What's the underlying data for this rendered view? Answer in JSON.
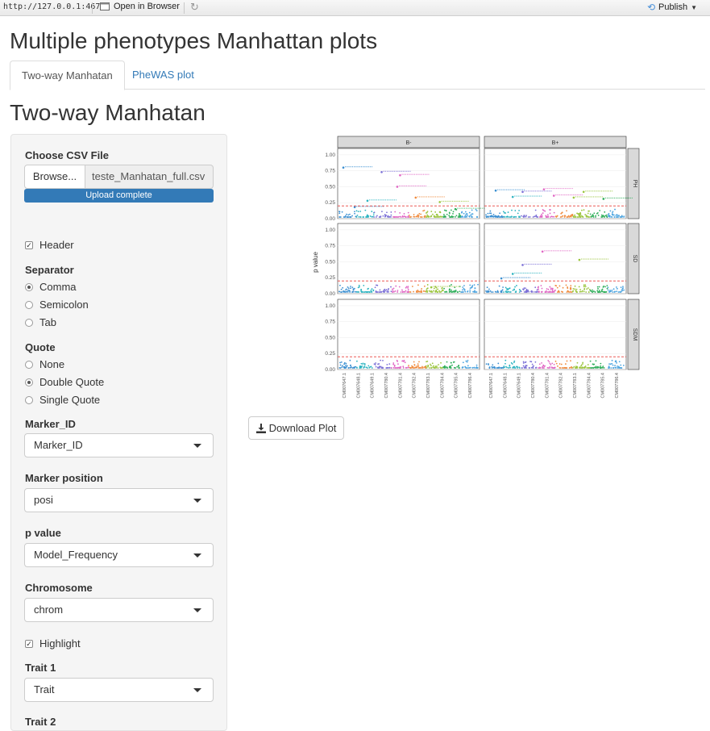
{
  "browser": {
    "url": "http://127.0.0.1:4679",
    "open_in_browser": "Open in Browser",
    "publish": "Publish"
  },
  "app_title": "Multiple phenotypes Manhattan plots",
  "tabs": [
    {
      "label": "Two-way Manhatan",
      "active": true
    },
    {
      "label": "PheWAS plot",
      "active": false
    }
  ],
  "section_title": "Two-way Manhatan",
  "sidebar": {
    "file_label": "Choose CSV File",
    "browse_label": "Browse...",
    "file_name": "teste_Manhatan_full.csv",
    "upload_status": "Upload complete",
    "header_label": "Header",
    "header_checked": true,
    "separator_label": "Separator",
    "separator_options": [
      "Comma",
      "Semicolon",
      "Tab"
    ],
    "separator_selected": "Comma",
    "quote_label": "Quote",
    "quote_options": [
      "None",
      "Double Quote",
      "Single Quote"
    ],
    "quote_selected": "Double Quote",
    "marker_id_label": "Marker_ID",
    "marker_id_value": "Marker_ID",
    "marker_pos_label": "Marker position",
    "marker_pos_value": "posi",
    "pvalue_label": "p value",
    "pvalue_value": "Model_Frequency",
    "chrom_label": "Chromosome",
    "chrom_value": "chrom",
    "highlight_label": "Highlight",
    "highlight_checked": true,
    "trait1_label": "Trait 1",
    "trait1_value": "Trait",
    "trait2_label": "Trait 2"
  },
  "download_label": "Download Plot",
  "chart_data": {
    "type": "scatter",
    "facet_columns": [
      "B-",
      "B+"
    ],
    "facet_rows": [
      "PH",
      "SD",
      "SDM"
    ],
    "ylabel": "p value",
    "yticks": [
      "1.00",
      "0.75",
      "0.50",
      "0.25",
      "0.00"
    ],
    "ylim": [
      0,
      1.1
    ],
    "threshold": 0.2,
    "xticks": [
      "CM007647.1",
      "CM007648.1",
      "CM007649.1",
      "CM007780.4",
      "CM007781.4",
      "CM007782.4",
      "CM007783.1",
      "CM007784.4",
      "CM007785.4",
      "CM007786.4"
    ],
    "colors": [
      "#3a8fd1",
      "#2bb3c0",
      "#7b6fd6",
      "#e066c4",
      "#f08a3c",
      "#9bc53d",
      "#2fae5a",
      "#4aa3df"
    ],
    "highlights": [
      {
        "facet": "B-/PH",
        "points": [
          [
            0.04,
            0.8
          ],
          [
            0.31,
            0.73
          ],
          [
            0.44,
            0.68
          ],
          [
            0.42,
            0.5
          ],
          [
            0.21,
            0.28
          ],
          [
            0.55,
            0.33
          ],
          [
            0.12,
            0.18
          ],
          [
            0.72,
            0.26
          ],
          [
            0.83,
            0.15
          ]
        ]
      },
      {
        "facet": "B+/PH",
        "points": [
          [
            0.08,
            0.44
          ],
          [
            0.27,
            0.42
          ],
          [
            0.42,
            0.46
          ],
          [
            0.49,
            0.36
          ],
          [
            0.7,
            0.42
          ],
          [
            0.84,
            0.31
          ],
          [
            0.63,
            0.33
          ],
          [
            0.2,
            0.34
          ]
        ]
      },
      {
        "facet": "B-/SD",
        "points": [
          [
            0.66,
            0.1
          ]
        ]
      },
      {
        "facet": "B+/SD",
        "points": [
          [
            0.41,
            0.66
          ],
          [
            0.67,
            0.53
          ],
          [
            0.27,
            0.45
          ],
          [
            0.2,
            0.31
          ],
          [
            0.12,
            0.24
          ]
        ]
      },
      {
        "facet": "B-/SDM",
        "points": []
      },
      {
        "facet": "B+/SDM",
        "points": []
      }
    ]
  }
}
